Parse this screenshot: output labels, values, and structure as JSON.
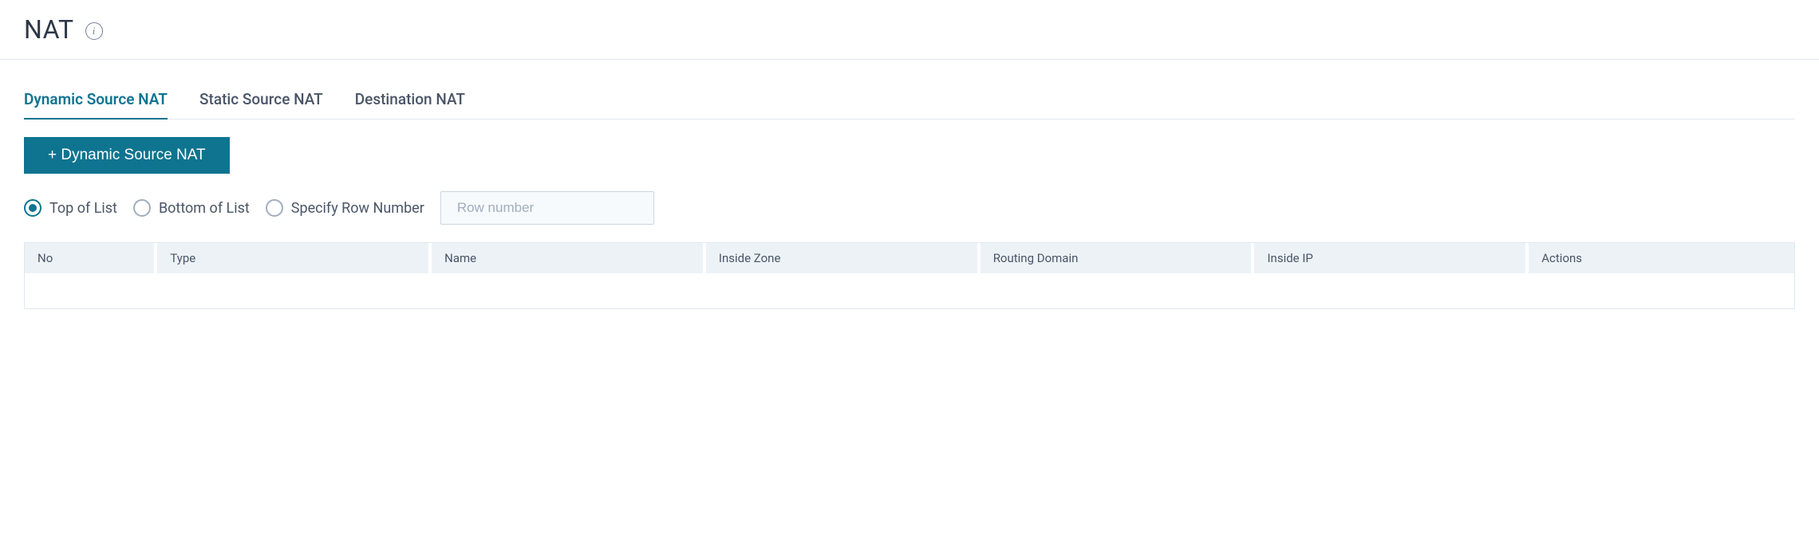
{
  "header": {
    "title": "NAT"
  },
  "tabs": [
    {
      "label": "Dynamic Source NAT",
      "active": true
    },
    {
      "label": "Static Source NAT",
      "active": false
    },
    {
      "label": "Destination NAT",
      "active": false
    }
  ],
  "add_button": {
    "label": "+ Dynamic Source NAT"
  },
  "placement": {
    "options": [
      {
        "label": "Top of List",
        "selected": true
      },
      {
        "label": "Bottom of List",
        "selected": false
      },
      {
        "label": "Specify Row Number",
        "selected": false
      }
    ],
    "row_number_placeholder": "Row number",
    "row_number_value": ""
  },
  "table": {
    "columns": [
      "No",
      "Type",
      "Name",
      "Inside Zone",
      "Routing Domain",
      "Inside IP",
      "Actions"
    ],
    "rows": []
  }
}
